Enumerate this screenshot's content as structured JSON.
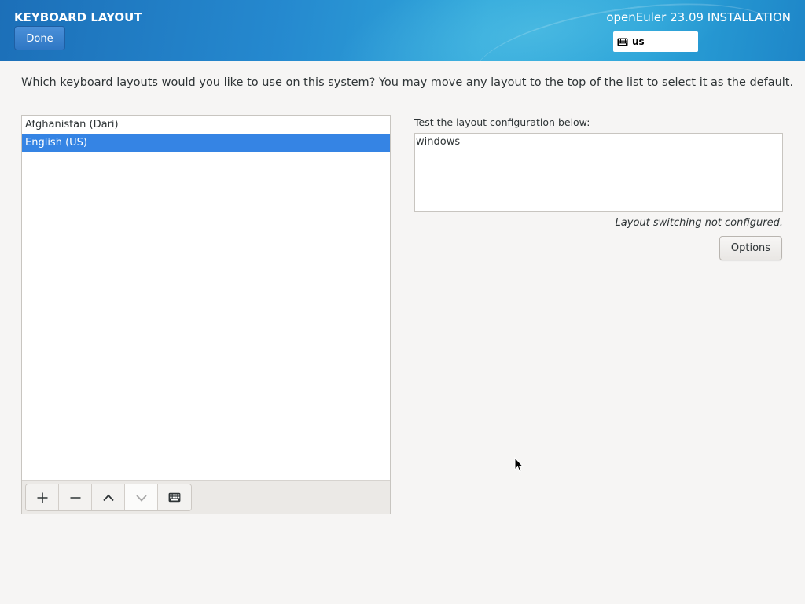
{
  "header": {
    "spoke_title": "KEYBOARD LAYOUT",
    "done_label": "Done",
    "product_title": "openEuler 23.09 INSTALLATION",
    "layout_indicator": {
      "icon": "keyboard-icon",
      "code": "us"
    }
  },
  "main": {
    "instructions": "Which keyboard layouts would you like to use on this system?  You may move any layout to the top of the list to select it as the default.",
    "layouts": [
      {
        "label": "Afghanistan (Dari)",
        "selected": false
      },
      {
        "label": "English (US)",
        "selected": true
      }
    ],
    "toolbar": {
      "buttons": [
        {
          "icon": "plus-icon",
          "enabled": true
        },
        {
          "icon": "minus-icon",
          "enabled": true
        },
        {
          "icon": "chevron-up-icon",
          "enabled": true
        },
        {
          "icon": "chevron-down-icon",
          "enabled": false
        },
        {
          "icon": "keyboard-icon",
          "enabled": true
        }
      ]
    },
    "test": {
      "label": "Test the layout configuration below:",
      "value": "windows"
    },
    "switch_status": "Layout switching not configured.",
    "options_label": "Options"
  },
  "colors": {
    "header_accent": "#2589cf",
    "selection": "#3584e4",
    "done_button": "#3a84d0"
  }
}
